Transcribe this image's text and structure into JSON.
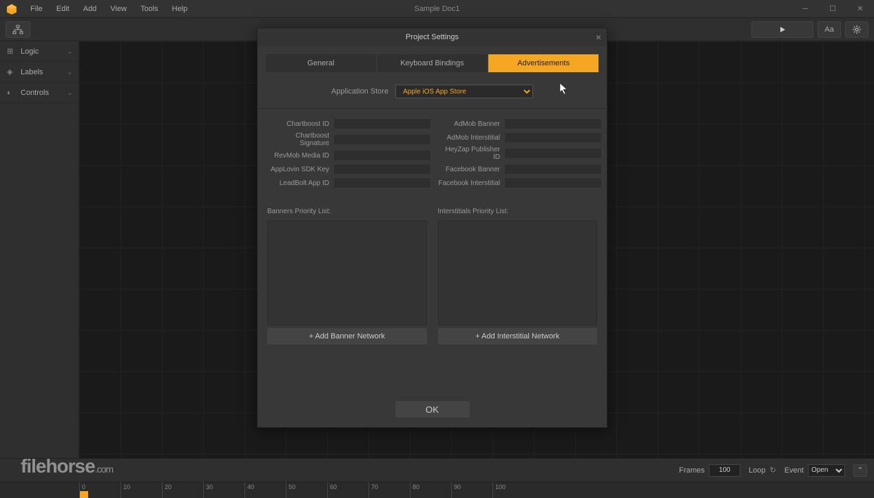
{
  "window": {
    "title": "Sample Doc1"
  },
  "menu": {
    "file": "File",
    "edit": "Edit",
    "add": "Add",
    "view": "View",
    "tools": "Tools",
    "help": "Help"
  },
  "sidebar": {
    "logic": "Logic",
    "labels": "Labels",
    "controls": "Controls"
  },
  "dialog": {
    "title": "Project Settings",
    "tabs": {
      "general": "General",
      "keyboard": "Keyboard Bindings",
      "ads": "Advertisements"
    },
    "store_label": "Application Store",
    "store_value": "Apple iOS App Store",
    "fields_left": {
      "chartboost_id": "Chartboost ID",
      "chartboost_sig": "Chartboost Signature",
      "revmob": "RevMob Media ID",
      "applovin": "AppLovin SDK Key",
      "leadbolt": "LeadBolt App ID"
    },
    "fields_right": {
      "admob_banner": "AdMob Banner",
      "admob_interstitial": "AdMob Interstitial",
      "heyzap": "HeyZap Publisher ID",
      "facebook_banner": "Facebook Banner",
      "facebook_interstitial": "Facebook Interstitial"
    },
    "banners_label": "Banners Priority List:",
    "interstitials_label": "Interstitials Priority List:",
    "add_banner": "Add Banner Network",
    "add_interstitial": "Add Interstitial Network",
    "ok": "OK"
  },
  "timeline": {
    "frames_label": "Frames",
    "frames_value": "100",
    "loop_label": "Loop",
    "event_label": "Event",
    "event_value": "Open"
  },
  "ruler": [
    "0",
    "10",
    "20",
    "30",
    "40",
    "50",
    "60",
    "70",
    "80",
    "90",
    "100"
  ],
  "watermark": {
    "main": "filehorse",
    "suffix": ".com"
  }
}
